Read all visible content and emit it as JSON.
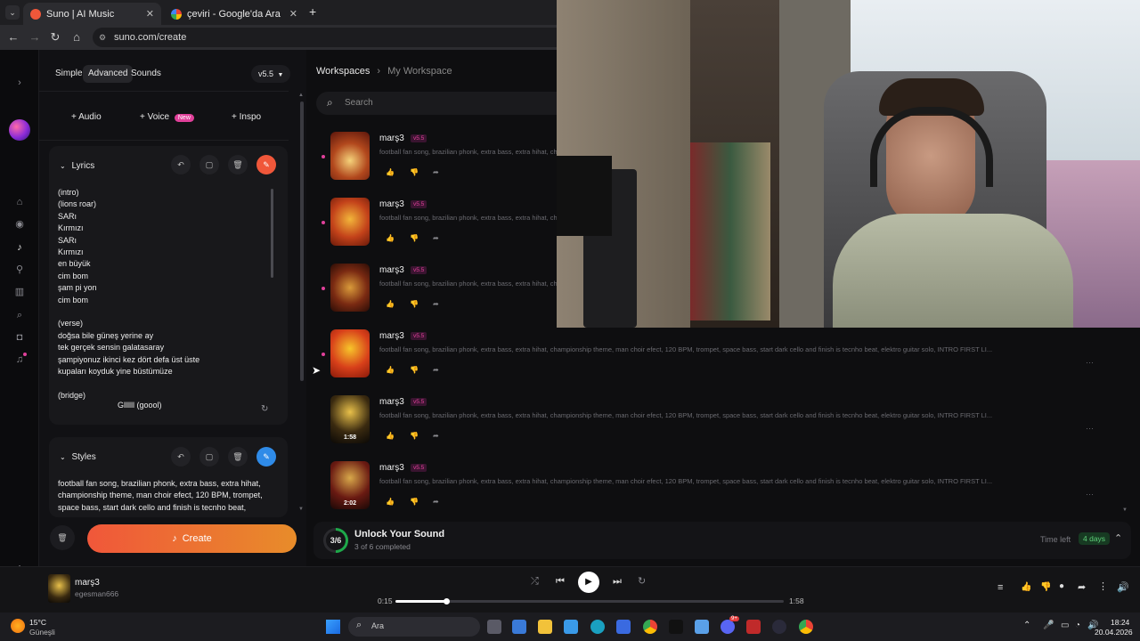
{
  "browser": {
    "tabs": [
      {
        "label": "Suno | AI Music",
        "active": true
      },
      {
        "label": "çeviri - Google'da Ara",
        "active": false
      }
    ],
    "url": "suno.com/create"
  },
  "panel": {
    "modes": [
      "Simple",
      "Advanced",
      "Sounds"
    ],
    "active_mode": "Advanced",
    "version": "v5.5",
    "add_buttons": [
      "Audio",
      "Voice",
      "Inspo"
    ],
    "voice_badge": "New",
    "lyrics_title": "Lyrics",
    "lyrics_text": "(intro)\n(lions roar)\nSARı\nKırmızı\nSARı\nKırmızı\nen büyük\ncim bom\nşam pi yon\ncim bom\n\n(verse)\ndoğsa bile güneş yerine ay\ntek gerçek sensin galatasaray\nşampiyonuz ikinci kez dört defa üst üste\nkupaları koyduk yine büstümüze\n\n(bridge)",
    "lyrics_last_line": "Gllllll (goool)",
    "styles_title": "Styles",
    "styles_text": "football fan song, brazilian phonk, extra bass, extra hihat, championship theme, man choir efect, 120 BPM, trompet, space bass, start dark cello and finish is tecnho beat, elektro",
    "create_label": "Create"
  },
  "workspace": {
    "breadcrumb_root": "Workspaces",
    "breadcrumb_current": "My Workspace",
    "search_placeholder": "Search",
    "songs": [
      {
        "title": "marş3",
        "version": "v5.5",
        "desc": "football fan song, brazilian phonk, extra bass, extra hihat, ch",
        "duration": ""
      },
      {
        "title": "marş3",
        "version": "v5.5",
        "desc": "football fan song, brazilian phonk, extra bass, extra hihat, ch",
        "duration": ""
      },
      {
        "title": "marş3",
        "version": "v5.5",
        "desc": "football fan song, brazilian phonk, extra bass, extra hihat, ch",
        "duration": ""
      },
      {
        "title": "marş3",
        "version": "v5.5",
        "desc": "football fan song, brazilian phonk, extra bass, extra hihat, championship theme, man choir efect, 120 BPM, trompet, space bass, start dark cello and finish is tecnho beat, elektro guitar solo, INTRO FIRST LI...",
        "duration": ""
      },
      {
        "title": "marş3",
        "version": "v5.5",
        "desc": "football fan song, brazilian phonk, extra bass, extra hihat, championship theme, man choir efect, 120 BPM, trompet, space bass, start dark cello and finish is tecnho beat, elektro guitar solo, INTRO FIRST LI...",
        "duration": "1:58"
      },
      {
        "title": "marş3",
        "version": "v5.5",
        "desc": "football fan song, brazilian phonk, extra bass, extra hihat, championship theme, man choir efect, 120 BPM, trompet, space bass, start dark cello and finish is tecnho beat, elektro guitar solo, INTRO FIRST LI...",
        "duration": "2:02"
      }
    ],
    "unlock": {
      "progress": "3/6",
      "title": "Unlock Your Sound",
      "subtitle": "3 of 6 completed",
      "time_left_label": "Time left",
      "time_left_value": "4 days"
    }
  },
  "player": {
    "title": "marş3",
    "artist": "egesman666",
    "elapsed": "0:15",
    "total": "1:58",
    "progress_fraction": 0.13
  },
  "taskbar": {
    "weather_temp": "15°C",
    "weather_desc": "Güneşli",
    "search_label": "Ara",
    "time": "18:24",
    "date": "20.04.2026",
    "notif_count": "9+"
  },
  "colors": {
    "accent_pink": "#e0409a",
    "create_gradient_start": "#f0573a",
    "create_gradient_end": "#e88c2a",
    "green_badge": "#1e7a3a"
  }
}
